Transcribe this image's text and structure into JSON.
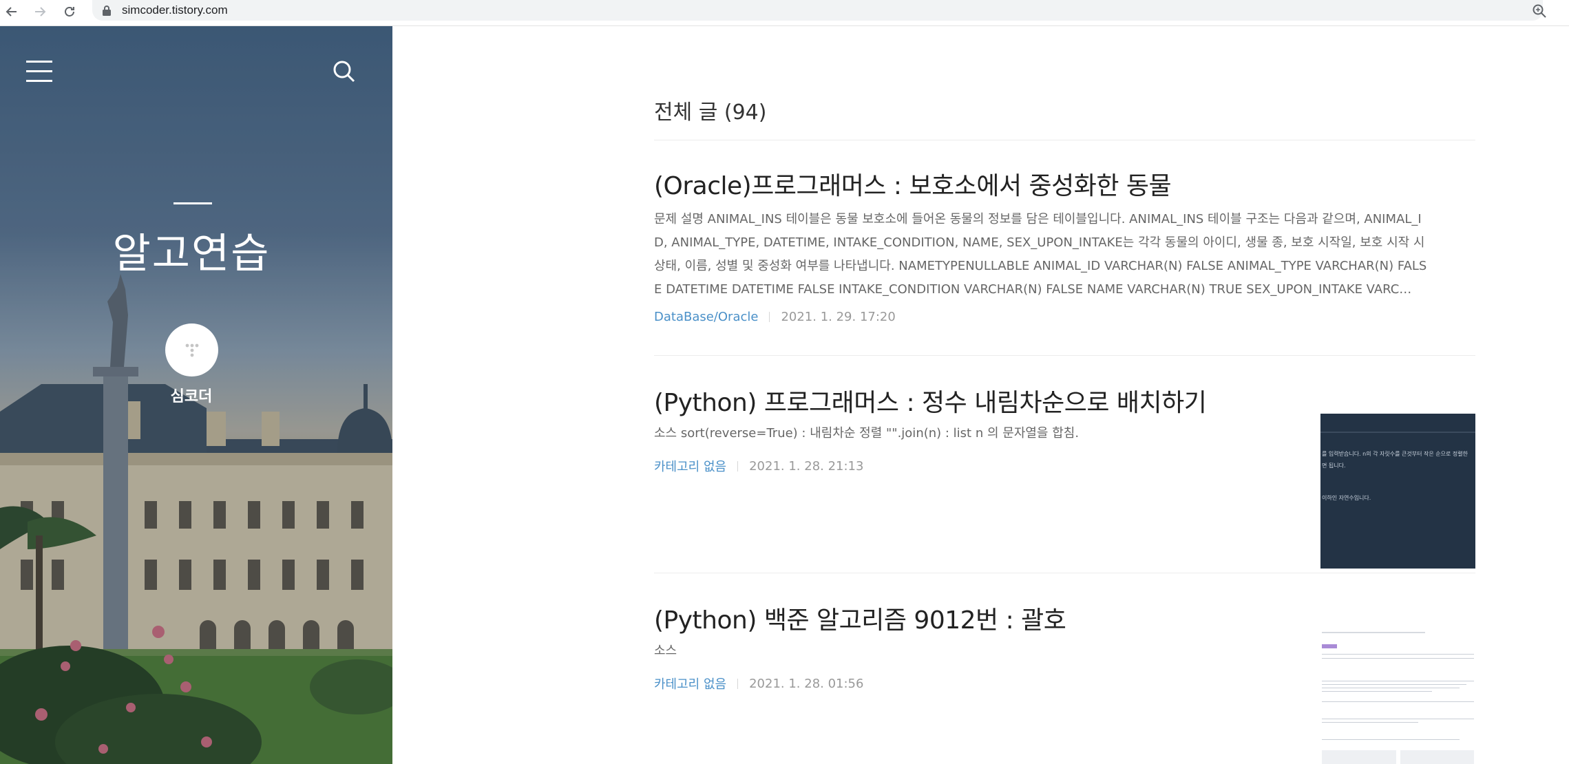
{
  "browser": {
    "url": "simcoder.tistory.com"
  },
  "sidebar": {
    "blog_title": "알고연습",
    "author": "심코더"
  },
  "content": {
    "section_title": "전체 글 (94)",
    "posts": [
      {
        "title": "(Oracle)프로그래머스 : 보호소에서 중성화한 동물",
        "excerpt_lines": [
          "문제 설명 ANIMAL_INS 테이블은 동물 보호소에 들어온 동물의 정보를 담은 테이블입니다. ANIMAL_INS 테이블 구조는 다음과 같으며, ANIMAL_I",
          "D, ANIMAL_TYPE, DATETIME, INTAKE_CONDITION, NAME, SEX_UPON_INTAKE는 각각 동물의 아이디, 생물 종, 보호 시작일, 보호 시작 시",
          "상태, 이름, 성별 및 중성화 여부를 나타냅니다. NAMETYPENULLABLE ANIMAL_ID VARCHAR(N) FALSE ANIMAL_TYPE VARCHAR(N) FALS",
          "E DATETIME DATETIME FALSE INTAKE_CONDITION VARCHAR(N) FALSE NAME VARCHAR(N) TRUE SEX_UPON_INTAKE VARC…"
        ],
        "category": "DataBase/Oracle",
        "date": "2021. 1. 29. 17:20"
      },
      {
        "title": "(Python) 프로그래머스 : 정수 내림차순으로 배치하기",
        "excerpt_lines": [
          "소스 sort(reverse=True) : 내림차순 정렬 \"\".join(n) : list n 의 문자열을 합침."
        ],
        "category": "카테고리 없음",
        "date": "2021. 1. 28. 21:13",
        "thumb_lines": [
          "를 입력받습니다. n의 각 자릿수를 큰것부터 작은 순으로 정렬한",
          "면 됩니다.",
          "이하인 자연수입니다."
        ]
      },
      {
        "title": "(Python) 백준 알고리즘 9012번 : 괄호",
        "excerpt_lines": [
          "소스"
        ],
        "category": "카테고리 없음",
        "date": "2021. 1. 28. 01:56"
      }
    ]
  }
}
